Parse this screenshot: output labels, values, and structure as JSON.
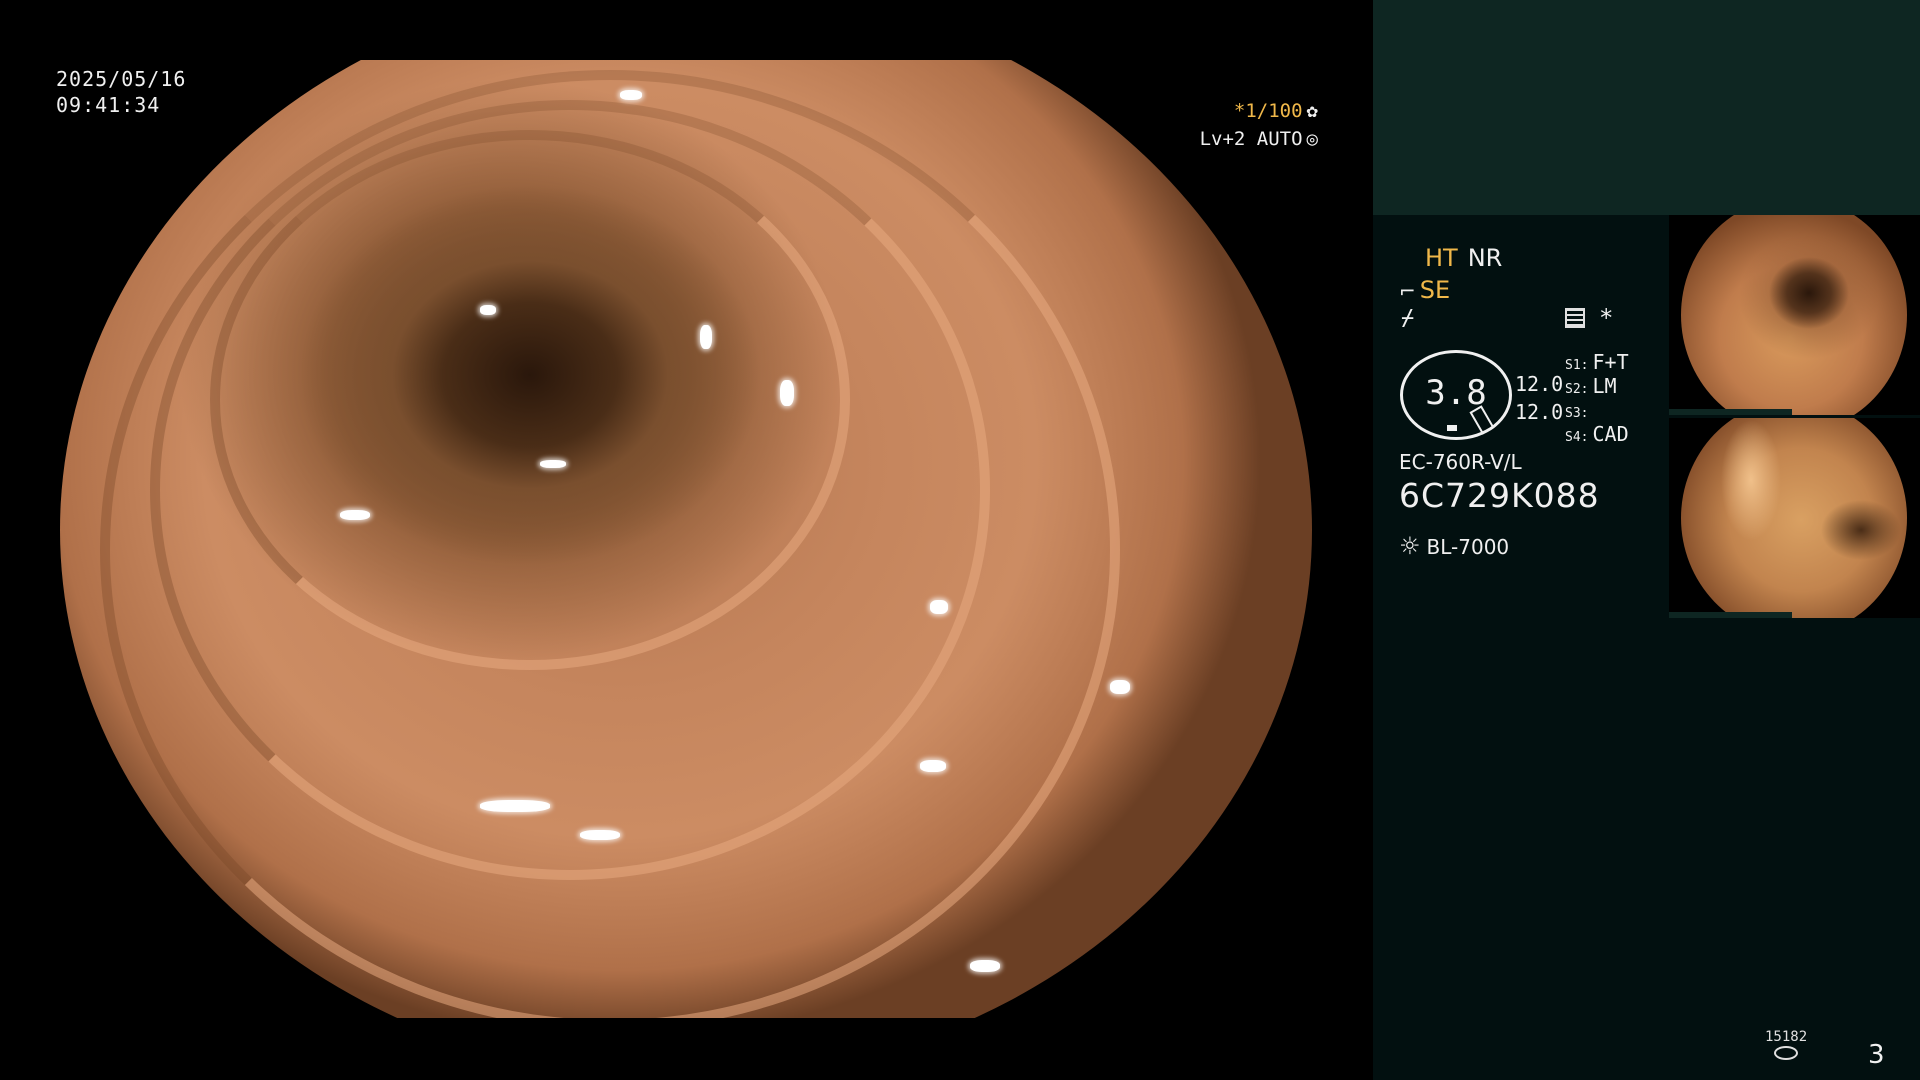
{
  "osd": {
    "date": "2025/05/16",
    "time": "09:41:34",
    "shutter": "*1/100",
    "shutter_icon": "aperture-icon",
    "level_auto": "Lv+2 AUTO",
    "auto_icon": "iris-icon"
  },
  "panel": {
    "modes": {
      "ht": "HT",
      "nr": "NR",
      "se": "SE"
    },
    "dial_value": "3.8",
    "values": [
      "12.0",
      "12.0"
    ],
    "s_modes": [
      {
        "key": "S1",
        "value": "F+T"
      },
      {
        "key": "S2",
        "value": "LM"
      },
      {
        "key": "S3",
        "value": ""
      },
      {
        "key": "S4",
        "value": "CAD"
      }
    ],
    "scope_model": "EC-760R-V/L",
    "scope_serial": "6C729K088",
    "light_source": "BL-7000",
    "storage_count": "15182",
    "page_number": "3"
  },
  "colors": {
    "accent_yellow": "#f0b84a",
    "panel_dark": "#021010",
    "panel_top": "#0e2622"
  }
}
